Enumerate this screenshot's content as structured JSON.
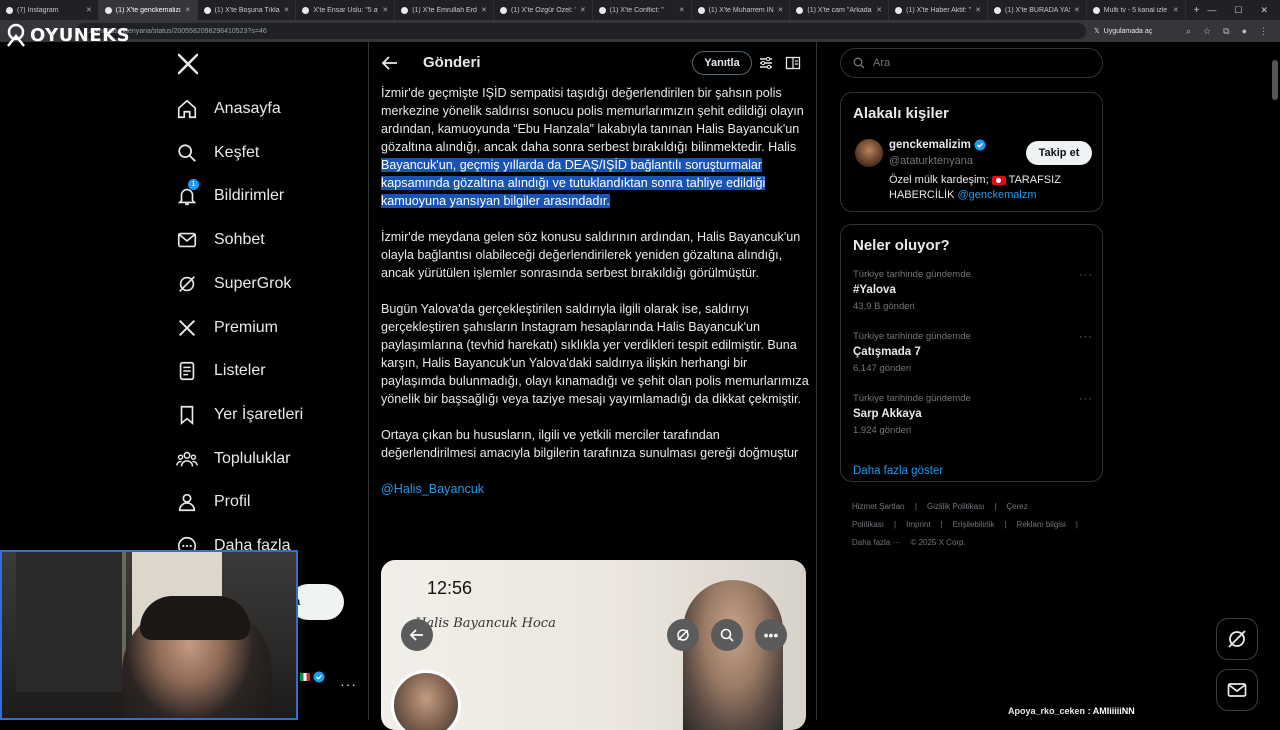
{
  "browser": {
    "tabs": [
      {
        "label": "(7) Instagram",
        "active": false
      },
      {
        "label": "(1) X'te genckemalizim",
        "active": true
      },
      {
        "label": "(1) X'te Boşuna Tıklam",
        "active": false
      },
      {
        "label": "X'te Ensar Uslu: \"5 ay ö",
        "active": false
      },
      {
        "label": "(1) X'te Emrullah Erdin",
        "active": false
      },
      {
        "label": "(1) X'te Özgür Özel: \"",
        "active": false
      },
      {
        "label": "(1) X'te Conflict: \"",
        "active": false
      },
      {
        "label": "(1) X'te Muharrem İNC",
        "active": false
      },
      {
        "label": "(1) X'te cam \"Arkadaşl",
        "active": false
      },
      {
        "label": "(1) X'te Haber Aktif: \"",
        "active": false
      },
      {
        "label": "(1) X'te BURADA YAŞA",
        "active": false
      },
      {
        "label": "Multi tv - 5 kanal izle",
        "active": false
      }
    ],
    "url": "x.com/ataturktenyana/status/2005582098296410523?s=46",
    "app_pill": "Uygulamada aç"
  },
  "overlay": {
    "brand": "OYUNEKS",
    "chat_user": "Apoya_rko_ceken",
    "chat_text": ": AMIiiiiiNN"
  },
  "sidebar": {
    "items": [
      {
        "label": "Anasayfa",
        "icon": "home-icon"
      },
      {
        "label": "Keşfet",
        "icon": "search-icon"
      },
      {
        "label": "Bildirimler",
        "icon": "bell-icon",
        "badge": "1"
      },
      {
        "label": "Sohbet",
        "icon": "mail-icon"
      },
      {
        "label": "SuperGrok",
        "icon": "grok-icon"
      },
      {
        "label": "Premium",
        "icon": "x-icon"
      },
      {
        "label": "Listeler",
        "icon": "list-icon"
      },
      {
        "label": "Yer İşaretleri",
        "icon": "bookmark-icon"
      },
      {
        "label": "Topluluklar",
        "icon": "communities-icon"
      },
      {
        "label": "Profil",
        "icon": "profile-icon"
      },
      {
        "label": "Daha fazla",
        "icon": "more-icon"
      }
    ],
    "post_partial": "a"
  },
  "post": {
    "header_title": "Gönderi",
    "reply_label": "Yanıtla",
    "p1_a": "İzmir'de geçmişte IŞİD sempatisi taşıdığı değerlendirilen bir şahsın polis merkezine yönelik saldırısı sonucu polis memurlarımızın şehit edildiği olayın ardından, kamuoyunda “Ebu Hanzala” lakabıyla tanınan Halis Bayancuk'un gözaltına alındığı, ancak daha sonra serbest bırakıldığı bilinmektedir. Halis ",
    "p1_hl": "Bayancuk'un, geçmiş yıllarda da DEAŞ/IŞİD bağlantılı soruşturmalar kapsamında gözaltına alındığı ve tutuklandıktan sonra tahliye edildiği kamuoyuna yansıyan bilgiler arasındadır.",
    "p2": "İzmir'de meydana gelen söz konusu saldırının ardından, Halis Bayancuk'un olayla bağlantısı olabileceği değerlendirilerek yeniden gözaltına alındığı, ancak yürütülen işlemler sonrasında serbest bırakıldığı görülmüştür.",
    "p3": "Bugün Yalova'da gerçekleştirilen saldırıyla ilgili olarak ise, saldırıyı gerçekleştiren şahısların Instagram hesaplarında Halis Bayancuk'un paylaşımlarına (tevhid harekatı) sıklıkla yer verdikleri tespit edilmiştir. Buna karşın, Halis Bayancuk'un Yalova'daki saldırıya ilişkin herhangi bir paylaşımda bulunmadığı, olayı kınamadığı ve şehit olan polis memurlarımıza yönelik bir başsağlığı veya taziye mesajı yayımlamadığı da dikkat çekmiştir.",
    "p4": "Ortaya çıkan bu hususların, ilgili ve yetkili merciler tarafından değerlendirilmesi amacıyla bilgilerin tarafınıza sunulması gereği doğmuştur",
    "mention": "@Halis_Bayancuk",
    "media": {
      "time": "12:56",
      "script": "Halis Bayancuk Hoca"
    }
  },
  "right": {
    "search_placeholder": "Ara",
    "related_title": "Alakalı kişiler",
    "person": {
      "name": "genckemalizim",
      "handle": "@ataturktenyana",
      "bio_a": "Özel mülk kardeşim;",
      "bio_b": "TARAFSIZ HABERCİLİK",
      "bio_link": "@genckemalzm",
      "follow_label": "Takip et"
    },
    "trends_title": "Neler oluyor?",
    "trends": [
      {
        "context": "Türkiye tarihinde gündemde",
        "title": "#Yalova",
        "count": "43,9 B gönderi"
      },
      {
        "context": "Türkiye tarihinde gündemde",
        "title": "Çatışmada 7",
        "count": "6.147 gönderi"
      },
      {
        "context": "Türkiye tarihinde gündemde",
        "title": "Sarp Akkaya",
        "count": "1.924 gönderi"
      }
    ],
    "show_more": "Daha fazla göster",
    "footer": [
      "Hizmet Şartları",
      "|",
      "Gizlilik Politikası",
      "|",
      "Çerez Politikası",
      "|",
      "Imprint",
      "|",
      "Erişilebilirlik",
      "|",
      "Reklam bilgisi",
      "|",
      "Daha fazla ···",
      "© 2025 X Corp."
    ]
  },
  "colors": {
    "accent": "#1d9bf0",
    "selection": "#1a53b8",
    "background": "#000000",
    "border": "#2f3336"
  }
}
